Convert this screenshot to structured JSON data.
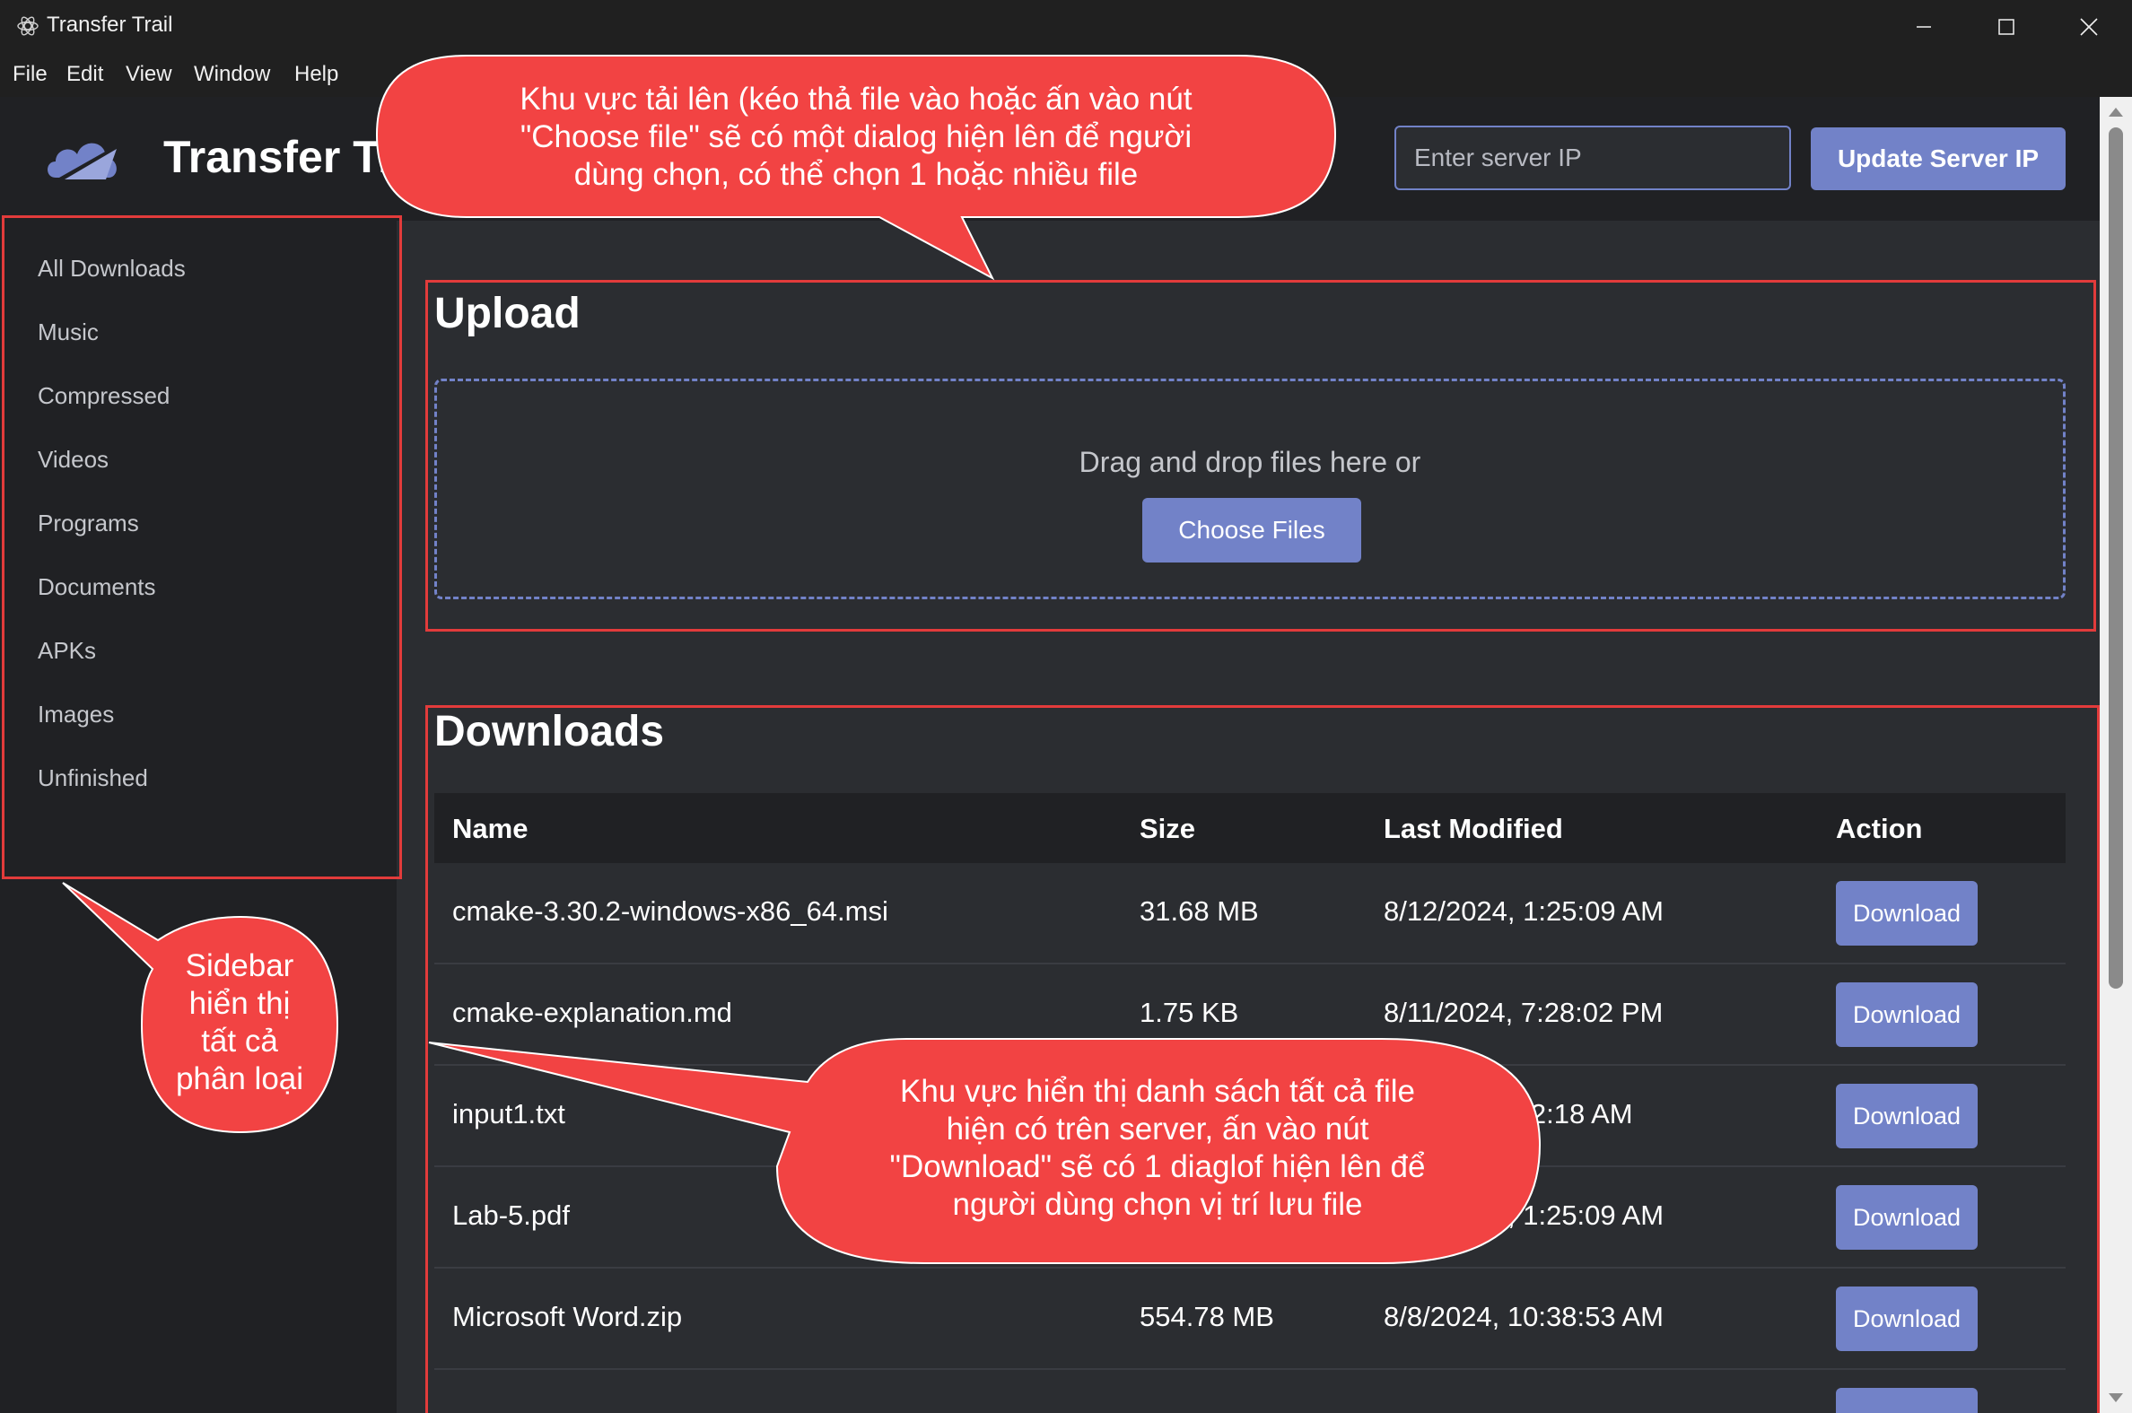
{
  "window": {
    "title": "Transfer Trail",
    "controls": [
      "minimize",
      "maximize",
      "close"
    ]
  },
  "menu": [
    "File",
    "Edit",
    "View",
    "Window",
    "Help"
  ],
  "header": {
    "brand": "Transfer Trail",
    "ip_placeholder": "Enter server IP",
    "update_label": "Update Server IP"
  },
  "sidebar": {
    "items": [
      "All Downloads",
      "Music",
      "Compressed",
      "Videos",
      "Programs",
      "Documents",
      "APKs",
      "Images",
      "Unfinished"
    ]
  },
  "upload": {
    "title": "Upload",
    "drop_text": "Drag and drop files here or",
    "choose_label": "Choose Files"
  },
  "downloads": {
    "title": "Downloads",
    "columns": [
      "Name",
      "Size",
      "Last Modified",
      "Action"
    ],
    "rows": [
      {
        "name": "cmake-3.30.2-windows-x86_64.msi",
        "size": "31.68 MB",
        "modified": "8/12/2024, 1:25:09 AM",
        "action": "Download"
      },
      {
        "name": "cmake-explanation.md",
        "size": "1.75 KB",
        "modified": "8/11/2024, 7:28:02 PM",
        "action": "Download"
      },
      {
        "name": "input1.txt",
        "size": "",
        "modified": ":52:18 AM",
        "action": "Download"
      },
      {
        "name": "Lab-5.pdf",
        "size": "",
        "modified": ", 1:25:09 AM",
        "action": "Download"
      },
      {
        "name": "Microsoft Word.zip",
        "size": "554.78 MB",
        "modified": "8/8/2024, 10:38:53 AM",
        "action": "Download"
      }
    ]
  },
  "annotations": {
    "upload_note": "Khu vực tải lên (kéo thả file vào hoặc ấn vào nút \"Choose file\" sẽ có một dialog hiện lên để người dùng chọn, có thể chọn 1 hoặc nhiều file",
    "upload_note_lines": [
      "Khu vực tải lên (kéo thả file vào hoặc ấn vào nút",
      "\"Choose file\" sẽ có một dialog hiện lên để người",
      "dùng chọn, có thể chọn 1 hoặc nhiều file"
    ],
    "sidebar_note_lines": [
      "Sidebar",
      "hiển thị",
      "tất cả",
      "phân loại"
    ],
    "downloads_note_lines": [
      "Khu vực hiển thị danh sách tất cả file",
      "hiện có trên server, ấn vào nút",
      "\"Download\" sẽ có 1 diaglof hiện lên để",
      "người dùng chọn vị trí lưu file"
    ]
  },
  "colors": {
    "background": "#2b2d31",
    "panel": "#202124",
    "accent": "#7282c8",
    "annotation": "#f24343"
  }
}
